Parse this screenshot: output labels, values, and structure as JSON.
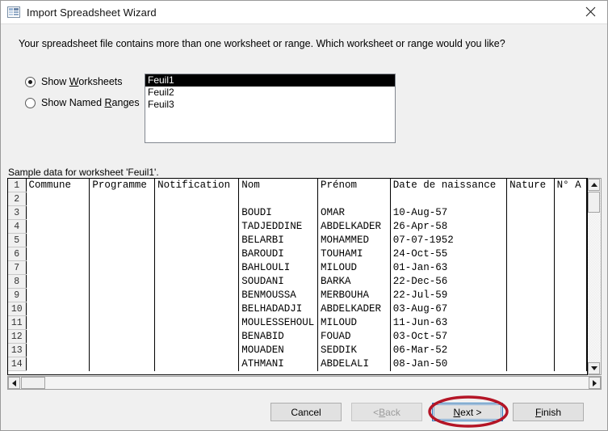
{
  "window": {
    "title": "Import Spreadsheet Wizard",
    "icon": "spreadsheet-wizard-icon",
    "close_label": "✕"
  },
  "headline": "Your spreadsheet file contains more than one worksheet or range. Which worksheet or range would you like?",
  "options": {
    "worksheets": {
      "label_pre": "Show ",
      "accel": "W",
      "label_post": "orksheets",
      "selected": true
    },
    "named_ranges": {
      "label_pre": "Show Named ",
      "accel": "R",
      "label_post": "anges",
      "selected": false
    }
  },
  "listbox": {
    "items": [
      {
        "label": "Feuil1",
        "selected": true
      },
      {
        "label": "Feuil2",
        "selected": false
      },
      {
        "label": "Feuil3",
        "selected": false
      }
    ]
  },
  "sample_label": "Sample data for worksheet 'Feuil1'.",
  "grid": {
    "columns": [
      "Commune",
      "Programme",
      "Notification",
      "Nom",
      "Prénom",
      "Date de naissance",
      "Nature",
      "N° A"
    ],
    "rows": [
      {
        "n": "1",
        "cells": [
          "Commune",
          "Programme",
          "Notification",
          "Nom",
          "Prénom",
          "Date de naissance",
          "Nature",
          "N° A"
        ]
      },
      {
        "n": "2",
        "cells": [
          "",
          "",
          "",
          "",
          "",
          "",
          "",
          ""
        ]
      },
      {
        "n": "3",
        "cells": [
          "",
          "",
          "",
          "BOUDI",
          "OMAR",
          "10-Aug-57",
          "",
          ""
        ]
      },
      {
        "n": "4",
        "cells": [
          "",
          "",
          "",
          "TADJEDDINE",
          "ABDELKADER",
          "26-Apr-58",
          "",
          ""
        ]
      },
      {
        "n": "5",
        "cells": [
          "",
          "",
          "",
          "BELARBI",
          "MOHAMMED",
          "07-07-1952",
          "",
          ""
        ]
      },
      {
        "n": "6",
        "cells": [
          "",
          "",
          "",
          "BAROUDI",
          "TOUHAMI",
          "24-Oct-55",
          "",
          ""
        ]
      },
      {
        "n": "7",
        "cells": [
          "",
          "",
          "",
          "BAHLOULI",
          "MILOUD",
          "01-Jan-63",
          "",
          ""
        ]
      },
      {
        "n": "8",
        "cells": [
          "",
          "",
          "",
          "SOUDANI",
          "BARKA",
          "22-Dec-56",
          "",
          ""
        ]
      },
      {
        "n": "9",
        "cells": [
          "",
          "",
          "",
          "BENMOUSSA",
          "MERBOUHA",
          "22-Jul-59",
          "",
          ""
        ]
      },
      {
        "n": "10",
        "cells": [
          "",
          "",
          "",
          "BELHADADJI",
          "ABDELKADER",
          "03-Aug-67",
          "",
          ""
        ]
      },
      {
        "n": "11",
        "cells": [
          "",
          "",
          "",
          "MOULESSEHOUL",
          "MILOUD",
          "11-Jun-63",
          "",
          ""
        ]
      },
      {
        "n": "12",
        "cells": [
          "",
          "",
          "",
          "BENABID",
          "FOUAD",
          "03-Oct-57",
          "",
          ""
        ]
      },
      {
        "n": "13",
        "cells": [
          "",
          "",
          "",
          "MOUADEN",
          "SEDDIK",
          "06-Mar-52",
          "",
          ""
        ]
      },
      {
        "n": "14",
        "cells": [
          "",
          "",
          "",
          "ATHMANI",
          "ABDELALI",
          "08-Jan-50",
          "",
          ""
        ]
      }
    ]
  },
  "buttons": {
    "cancel": "Cancel",
    "back_pre": "< ",
    "back_accel": "B",
    "back_post": "ack",
    "next_pre": "",
    "next_accel": "N",
    "next_post": "ext >",
    "finish_pre": "",
    "finish_accel": "F",
    "finish_post": "inish"
  },
  "annotation": {
    "shape": "ellipse",
    "color": "#b41526",
    "target": "next-button"
  },
  "colors": {
    "dialog_bg": "#f0f0f0",
    "titlebar_bg": "#ffffff",
    "selection_bg": "#000000",
    "focus_border": "#2a7ac0",
    "annotation_red": "#b41526"
  }
}
